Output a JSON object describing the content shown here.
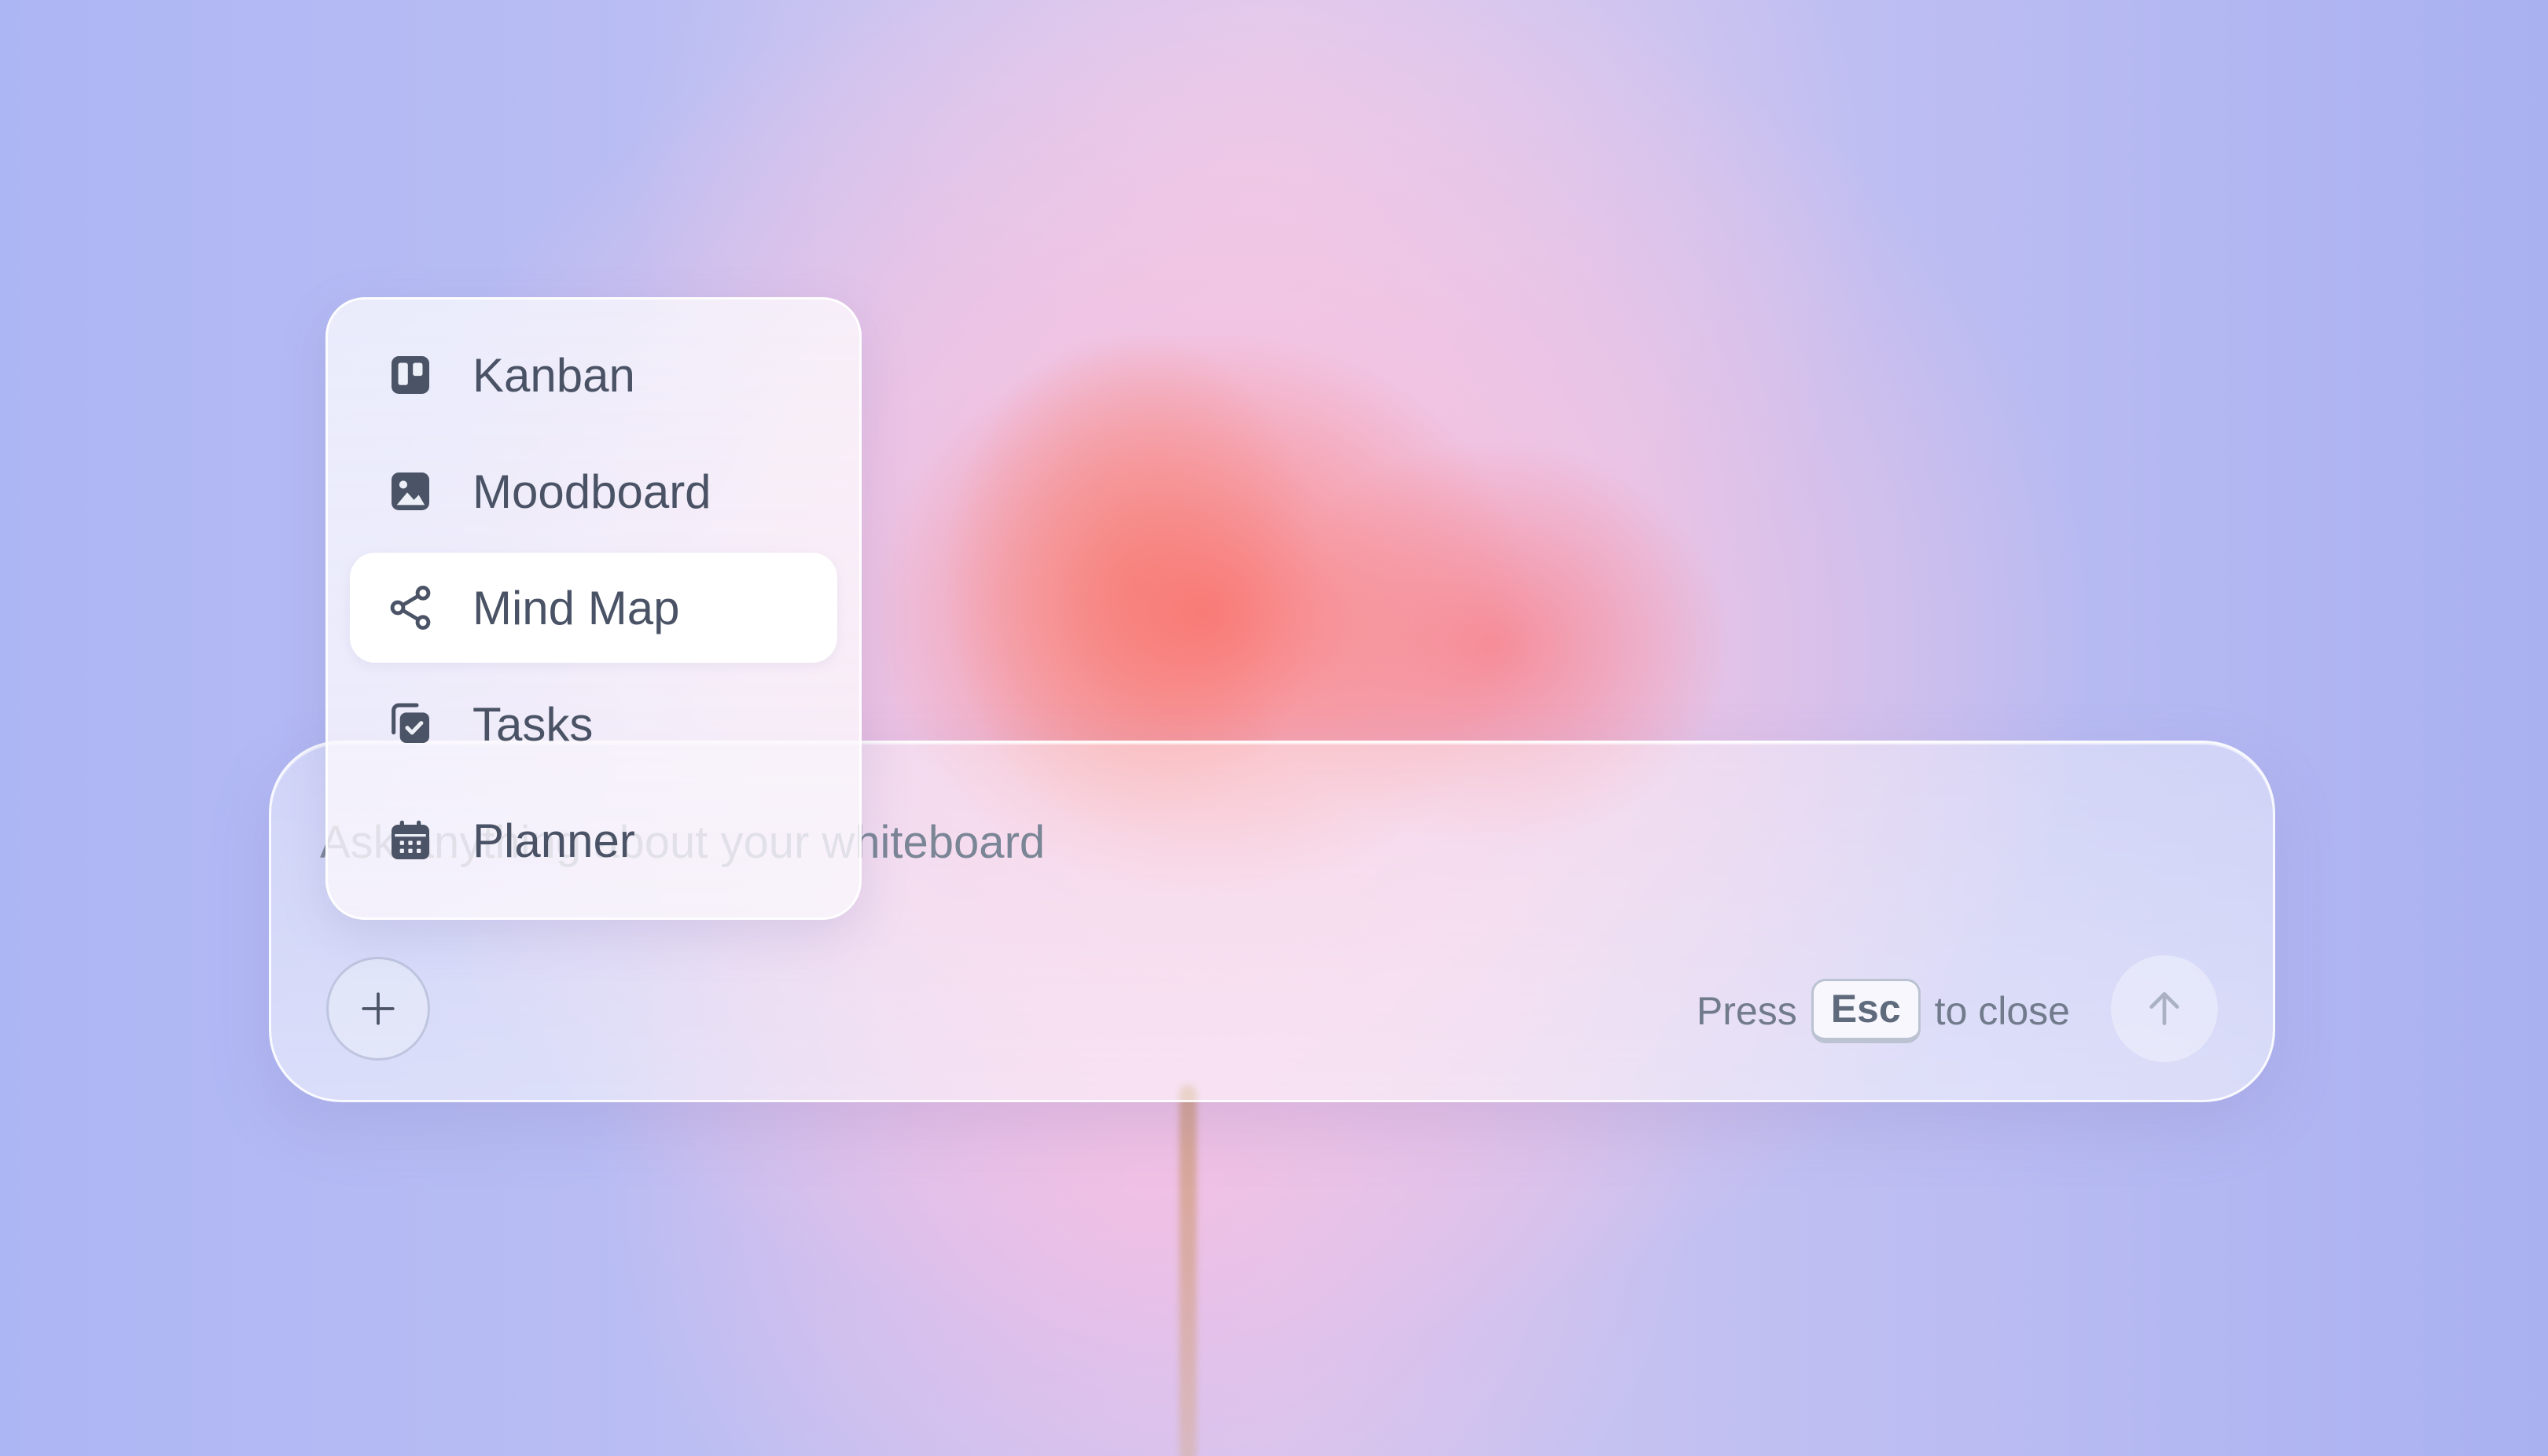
{
  "menu": {
    "items": [
      {
        "label": "Kanban",
        "icon": "kanban-icon"
      },
      {
        "label": "Moodboard",
        "icon": "image-icon"
      },
      {
        "label": "Mind Map",
        "icon": "share-nodes-icon",
        "active": true
      },
      {
        "label": "Tasks",
        "icon": "task-check-icon"
      },
      {
        "label": "Planner",
        "icon": "calendar-icon"
      }
    ]
  },
  "composer": {
    "placeholder": "Ask anything about your whiteboard",
    "hint_prefix": "Press",
    "hint_key": "Esc",
    "hint_suffix": "to close",
    "add_icon": "plus-icon",
    "send_icon": "arrow-up-icon"
  },
  "colors": {
    "icon": "#4b5366",
    "text": "#4a5365",
    "muted": "#717b8c"
  }
}
